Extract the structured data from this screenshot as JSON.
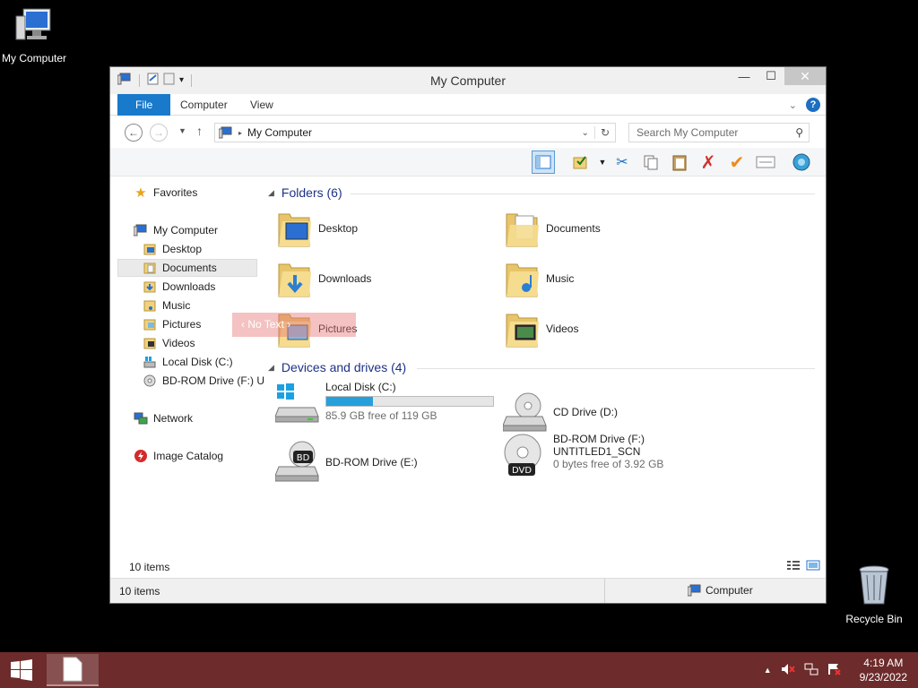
{
  "desktop": {
    "my_computer_label": "My Computer",
    "recycle_bin_label": "Recycle Bin"
  },
  "window": {
    "title": "My Computer",
    "ribbon_tabs": [
      "File",
      "Computer",
      "View"
    ],
    "address": "My Computer",
    "search_placeholder": "Search My Computer"
  },
  "nav": {
    "favorites": "Favorites",
    "my_computer": "My Computer",
    "items": [
      "Desktop",
      "Documents",
      "Downloads",
      "Music",
      "Pictures",
      "Videos",
      "Local Disk (C:)",
      "BD-ROM Drive (F:) U"
    ],
    "network": "Network",
    "image_catalog": "Image Catalog",
    "selected": "Documents"
  },
  "content": {
    "folders_header": "Folders (6)",
    "folders": [
      "Desktop",
      "Documents",
      "Downloads",
      "Music",
      "Pictures",
      "Videos"
    ],
    "devices_header": "Devices and drives (4)",
    "drives": {
      "c_name": "Local Disk (C:)",
      "c_free": "85.9 GB free of 119 GB",
      "c_used_fraction": 0.28,
      "d_name": "CD Drive (D:)",
      "e_name": "BD-ROM Drive (E:)",
      "f_name": "BD-ROM Drive (F:)",
      "f_label": "UNTITLED1_SCN",
      "f_free": "0 bytes free of 3.92 GB",
      "bd_badge": "BD",
      "dvd_badge": "DVD"
    },
    "tooltip": "‹ No Text ›"
  },
  "status": {
    "items_count": "10 items",
    "items_count_bottom": "10 items",
    "location": "Computer"
  },
  "taskbar": {
    "time": "4:19 AM",
    "date": "9/23/2022"
  },
  "colors": {
    "accent": "#1979ca",
    "taskbar": "#6d2b2b",
    "progress": "#26a0da",
    "group_header": "#1e3287"
  }
}
